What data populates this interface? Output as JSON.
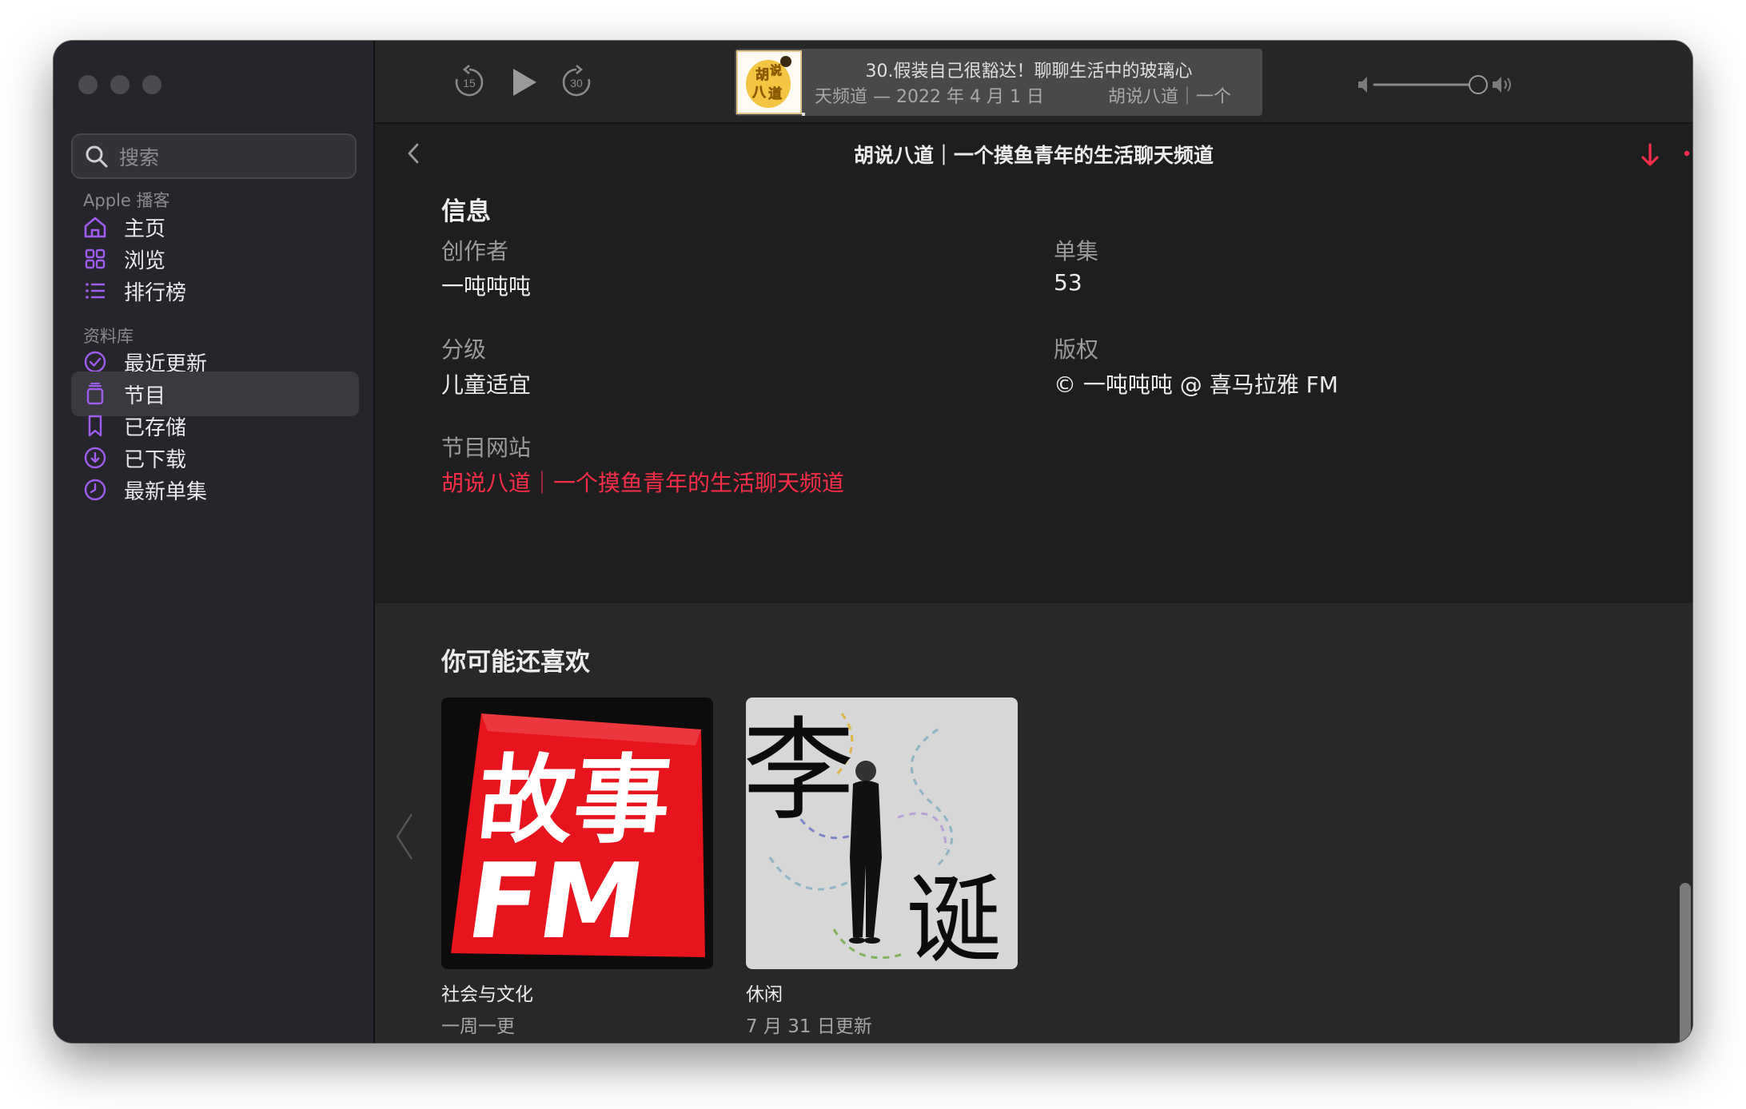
{
  "sidebar": {
    "search_placeholder": "搜索",
    "section_apple": "Apple 播客",
    "apple_items": [
      {
        "label": "主页",
        "icon": "home-icon"
      },
      {
        "label": "浏览",
        "icon": "grid-icon"
      },
      {
        "label": "排行榜",
        "icon": "list-icon"
      }
    ],
    "section_library": "资料库",
    "library_items": [
      {
        "label": "最近更新",
        "icon": "checkmark-circle-icon"
      },
      {
        "label": "节目",
        "icon": "stack-icon",
        "selected": true
      },
      {
        "label": "已存储",
        "icon": "bookmark-icon"
      },
      {
        "label": "已下载",
        "icon": "download-circle-icon"
      },
      {
        "label": "最新单集",
        "icon": "clock-icon"
      }
    ]
  },
  "player": {
    "skip_back_seconds": "15",
    "skip_forward_seconds": "30",
    "episode_title": "30.假装自己很豁达！聊聊生活中的玻璃心",
    "episode_subtitle_left": "天频道 — 2022 年 4 月 1 日",
    "episode_subtitle_right": "胡说八道｜一个",
    "artwork_text": "胡说八道",
    "volume": 0.9
  },
  "header": {
    "title": "胡说八道｜一个摸鱼青年的生活聊天频道"
  },
  "info": {
    "heading": "信息",
    "creator_label": "创作者",
    "creator_value": "一吨吨吨",
    "episodes_label": "单集",
    "episodes_value": "53",
    "rating_label": "分级",
    "rating_value": "儿童适宜",
    "copyright_label": "版权",
    "copyright_value": "© 一吨吨吨 @ 喜马拉雅 FM",
    "website_label": "节目网站",
    "website_value": "胡说八道｜一个摸鱼青年的生活聊天频道"
  },
  "recommendations": {
    "heading": "你可能还喜欢",
    "items": [
      {
        "genre": "社会与文化",
        "frequency": "一周一更",
        "art_text_top": "故事",
        "art_text_bottom": "FM"
      },
      {
        "genre": "休闲",
        "frequency": "7 月 31 日更新",
        "art_text_top": "李",
        "art_text_bottom": "诞"
      }
    ]
  },
  "colors": {
    "accent": "#fa2d48",
    "sidebar_icon": "#a05cf0",
    "sidebar_bg": "#26252c",
    "content_bg": "#1e1e1e"
  }
}
